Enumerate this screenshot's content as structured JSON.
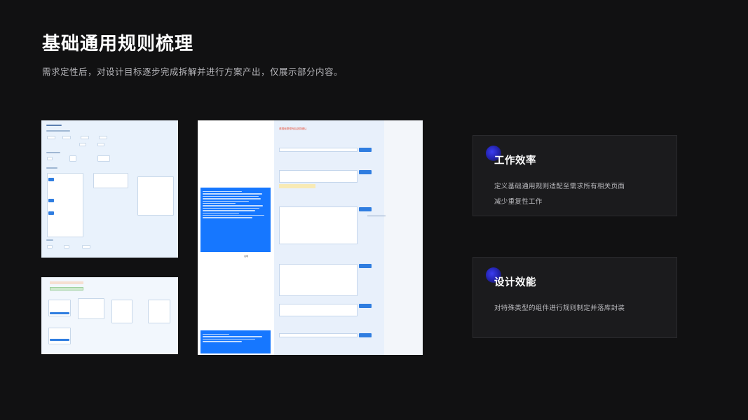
{
  "header": {
    "title": "基础通用规则梳理",
    "subtitle": "需求定性后，对设计目标逐步完成拆解并进行方案产出，仅展示部分内容。"
  },
  "screenshot": {
    "red_note": "请搜索联想完后选择确认",
    "caption": "说明"
  },
  "cards": [
    {
      "title": "工作效率",
      "desc_lines": [
        "定义基础通用规则适配至需求所有相关页面",
        "减少重复性工作"
      ]
    },
    {
      "title": "设计效能",
      "desc_lines": [
        "对特殊类型的组件进行规则制定并落库封装"
      ]
    }
  ],
  "colors": {
    "background": "#111112",
    "accent_blue": "#1677ff",
    "card_bg": "#1b1b1d"
  }
}
